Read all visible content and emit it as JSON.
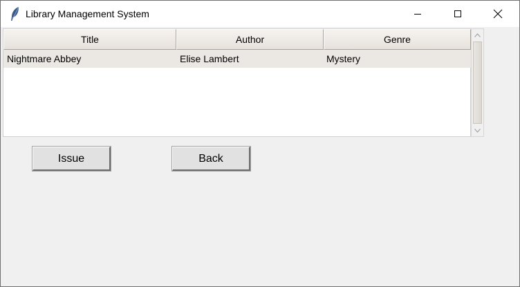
{
  "window": {
    "title": "Library Management System",
    "icon": "feather-icon",
    "controls": [
      "minimize-icon",
      "maximize-icon",
      "close-icon"
    ]
  },
  "table": {
    "columns": [
      "Title",
      "Author",
      "Genre"
    ],
    "rows": [
      [
        "Nightmare Abbey",
        "Elise Lambert",
        "Mystery"
      ]
    ]
  },
  "buttons": {
    "issue": "Issue",
    "back": "Back"
  }
}
